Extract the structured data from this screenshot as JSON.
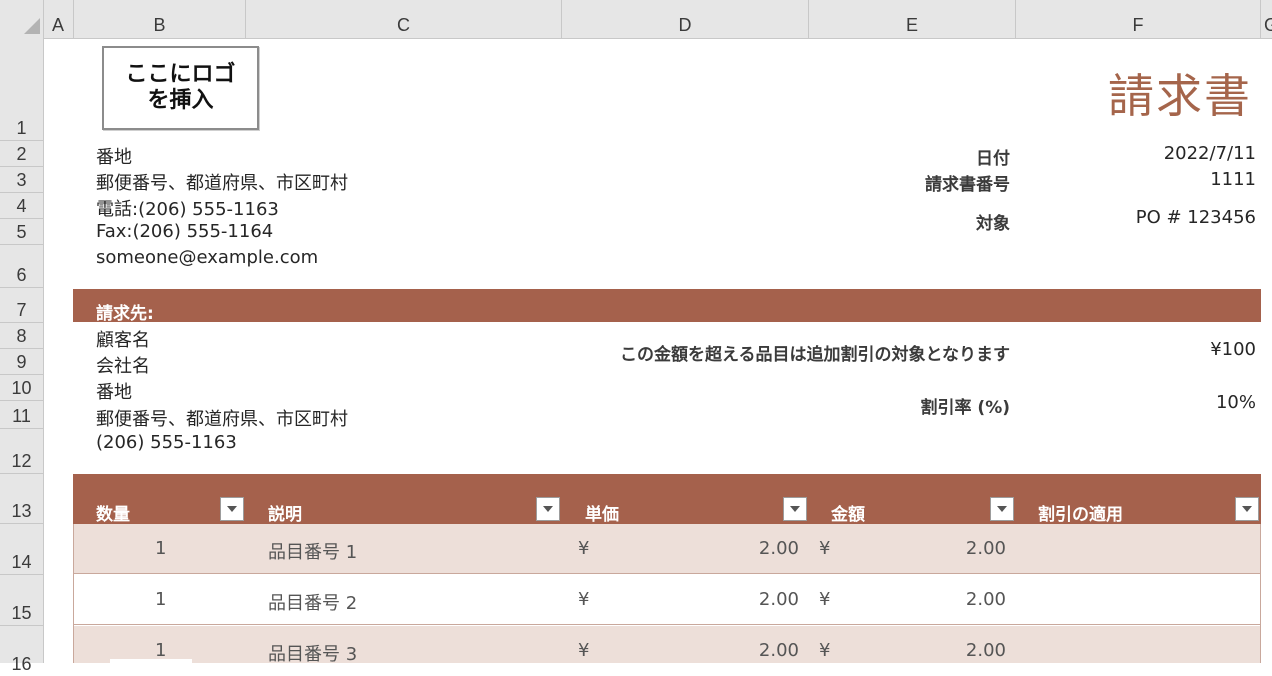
{
  "columns": [
    "A",
    "B",
    "C",
    "D",
    "E",
    "F",
    "G"
  ],
  "rows": [
    "1",
    "2",
    "3",
    "4",
    "5",
    "6",
    "7",
    "8",
    "9",
    "10",
    "11",
    "12",
    "13",
    "14",
    "15",
    "16"
  ],
  "logo": {
    "line1": "ここにロゴ",
    "line2": "を挿入"
  },
  "title": "請求書",
  "sender": {
    "street": "番地",
    "city": "郵便番号、都道府県、市区町村",
    "phone": "電話:(206) 555-1163",
    "fax": "Fax:(206) 555-1164",
    "email": "someone@example.com"
  },
  "meta": {
    "date_label": "日付",
    "date_value": "2022/7/11",
    "invoice_no_label": "請求書番号",
    "invoice_no_value": "1111",
    "target_label": "対象",
    "target_value": "PO # 123456"
  },
  "bill_to": {
    "header": "請求先:",
    "customer": "顧客名",
    "company": "会社名",
    "street": "番地",
    "city": "郵便番号、都道府県、市区町村",
    "phone": "(206) 555-1163"
  },
  "discount": {
    "threshold_label": "この金額を超える品目は追加割引の対象となります",
    "threshold_value": "¥100",
    "rate_label": "割引率 (%)",
    "rate_value": "10%"
  },
  "table": {
    "headers": [
      "数量",
      "説明",
      "単価",
      "金額",
      "割引の適用"
    ],
    "rows": [
      {
        "qty": "1",
        "desc": "品目番号 1",
        "unit_symbol": "¥",
        "unit": "2.00",
        "amount_symbol": "¥",
        "amount": "2.00",
        "discount": ""
      },
      {
        "qty": "1",
        "desc": "品目番号 2",
        "unit_symbol": "¥",
        "unit": "2.00",
        "amount_symbol": "¥",
        "amount": "2.00",
        "discount": ""
      },
      {
        "qty": "1",
        "desc": "品目番号 3",
        "unit_symbol": "¥",
        "unit": "2.00",
        "amount_symbol": "¥",
        "amount": "2.00",
        "discount": ""
      }
    ]
  },
  "colors": {
    "accent": "#a5614c",
    "row_shade": "#eddfd9",
    "title": "#a5654b"
  }
}
